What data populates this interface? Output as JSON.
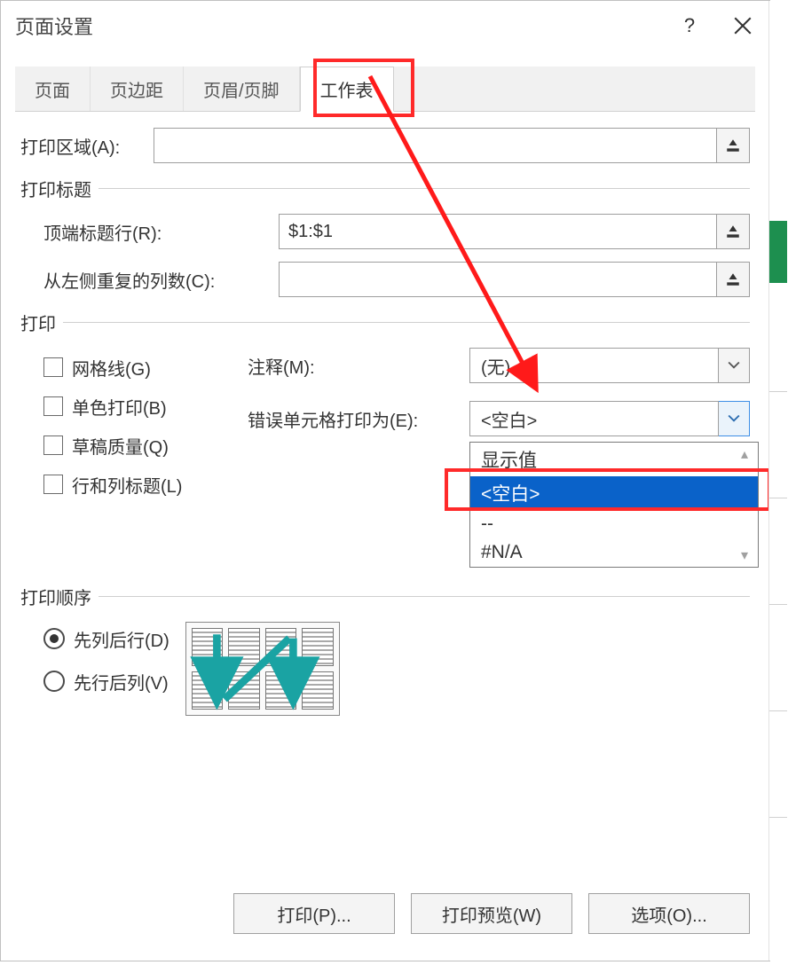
{
  "dialog": {
    "title": "页面设置",
    "help_tooltip": "?",
    "close_tooltip": "关闭"
  },
  "tabs": {
    "page": "页面",
    "margins": "页边距",
    "header_footer": "页眉/页脚",
    "sheet": "工作表"
  },
  "fields": {
    "print_area_label": "打印区域(A):",
    "print_area_value": "",
    "print_titles_section": "打印标题",
    "top_title_row_label": "顶端标题行(R):",
    "top_title_row_value": "$1:$1",
    "left_repeat_cols_label": "从左侧重复的列数(C):",
    "left_repeat_cols_value": ""
  },
  "print_section": {
    "title": "打印",
    "gridlines": "网格线(G)",
    "black_white": "单色打印(B)",
    "draft": "草稿质量(Q)",
    "row_col_headings": "行和列标题(L)",
    "comments_label": "注释(M):",
    "comments_value": "(无)",
    "errors_label": "错误单元格打印为(E):",
    "errors_value": "<空白>",
    "errors_options": {
      "display": "显示值",
      "blank": "<空白>",
      "dashes": "--",
      "na": "#N/A"
    }
  },
  "order_section": {
    "title": "打印顺序",
    "down_then_over": "先列后行(D)",
    "over_then_down": "先行后列(V)"
  },
  "buttons": {
    "print": "打印(P)...",
    "preview": "打印预览(W)",
    "options": "选项(O)..."
  }
}
